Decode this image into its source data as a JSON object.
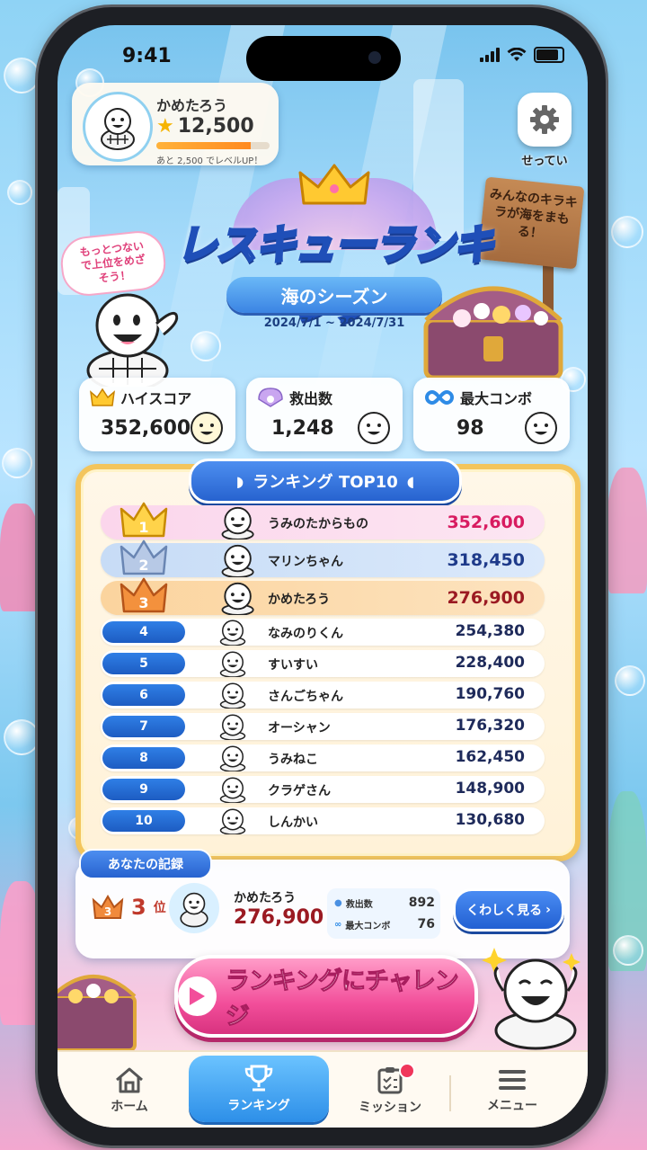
{
  "status": {
    "time": "9:41"
  },
  "profile": {
    "name": "かめたろう",
    "score": "12,500",
    "level_hint": "あと 2,500 でレベルUP！",
    "level_progress": 0.83
  },
  "settings": {
    "label": "せってい"
  },
  "sign": {
    "text": "みんなのキラキラが海をまもる！"
  },
  "speech": {
    "text": "もっとつないで上位をめざそう！"
  },
  "title": {
    "main": "レスキューランキング",
    "subtitle": "海のシーズン",
    "date_range": "2024/7/1 ~ 2024/7/31"
  },
  "stats": [
    {
      "label": "ハイスコア",
      "value": "352,600",
      "icon": "crown-icon"
    },
    {
      "label": "救出数",
      "value": "1,248",
      "icon": "shell-icon"
    },
    {
      "label": "最大コンボ",
      "value": "98",
      "icon": "infinity-icon"
    }
  ],
  "ranking": {
    "header": "ランキング TOP10",
    "rows": [
      {
        "rank": "1",
        "name": "うみのたからもの",
        "score": "352,600"
      },
      {
        "rank": "2",
        "name": "マリンちゃん",
        "score": "318,450"
      },
      {
        "rank": "3",
        "name": "かめたろう",
        "score": "276,900"
      },
      {
        "rank": "4",
        "name": "なみのりくん",
        "score": "254,380"
      },
      {
        "rank": "5",
        "name": "すいすい",
        "score": "228,400"
      },
      {
        "rank": "6",
        "name": "さんごちゃん",
        "score": "190,760"
      },
      {
        "rank": "7",
        "name": "オーシャン",
        "score": "176,320"
      },
      {
        "rank": "8",
        "name": "うみねこ",
        "score": "162,450"
      },
      {
        "rank": "9",
        "name": "クラゲさん",
        "score": "148,900"
      },
      {
        "rank": "10",
        "name": "しんかい",
        "score": "130,680"
      }
    ]
  },
  "record": {
    "tab": "あなたの記録",
    "rank": "3",
    "rank_suffix": "位",
    "name": "かめたろう",
    "score": "276,900",
    "rescue_label": "救出数",
    "rescue_value": "892",
    "combo_label": "最大コンボ",
    "combo_value": "76",
    "detail_button": "くわしく見る"
  },
  "challenge": {
    "label": "ランキングにチャレンジ"
  },
  "tabs": [
    {
      "label": "ホーム",
      "icon": "home-icon"
    },
    {
      "label": "ランキング",
      "icon": "trophy-icon"
    },
    {
      "label": "ミッション",
      "icon": "clipboard-icon"
    },
    {
      "label": "メニュー",
      "icon": "menu-icon"
    }
  ],
  "colors": {
    "rank1_score": "#d81b60",
    "rank2_score": "#1e3a8a",
    "rank3_score": "#9b1a22",
    "other_score": "#1e2a5a",
    "accent_blue": "#2763cf",
    "accent_pink": "#f24e9a"
  }
}
